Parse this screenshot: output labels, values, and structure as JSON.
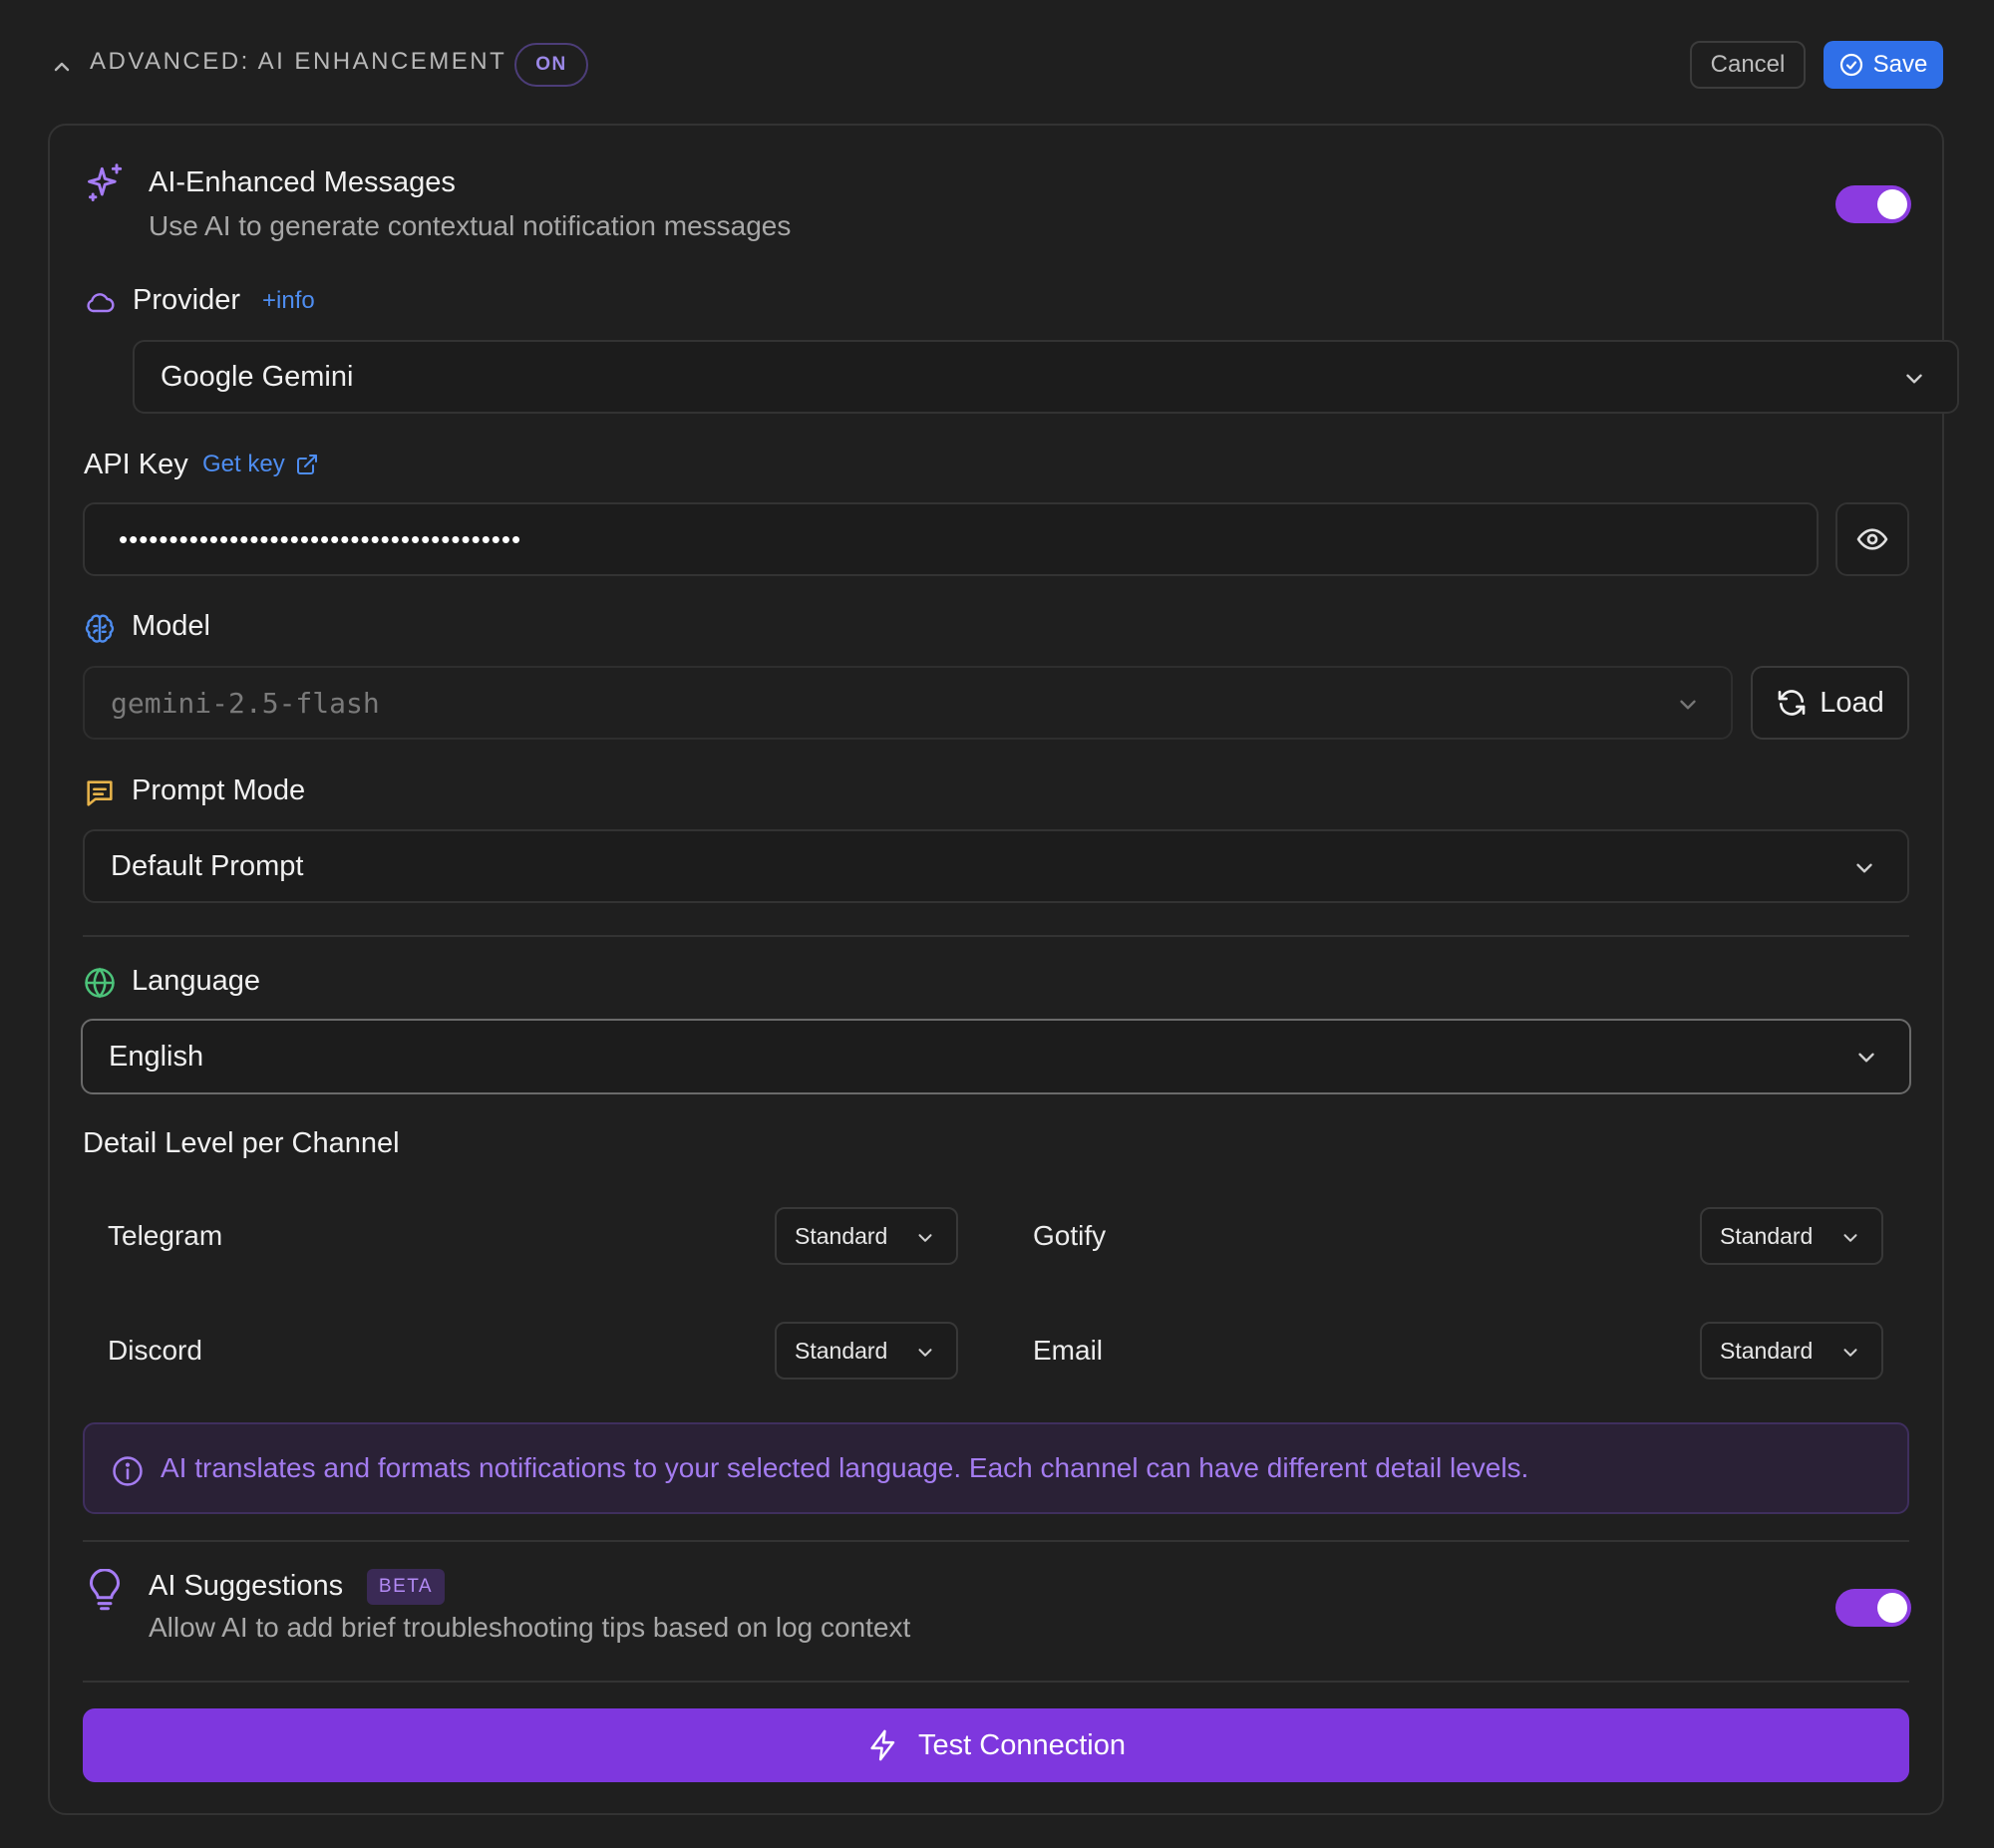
{
  "header": {
    "section_title": "ADVANCED: AI ENHANCEMENT",
    "status_badge": "ON",
    "cancel_label": "Cancel",
    "save_label": "Save"
  },
  "ai_messages": {
    "title": "AI-Enhanced Messages",
    "description": "Use AI to generate contextual notification messages",
    "enabled": true
  },
  "provider": {
    "label": "Provider",
    "info_link": "+info",
    "value": "Google Gemini"
  },
  "api_key": {
    "label": "API Key",
    "get_key_link": "Get key",
    "masked_value": "••••••••••••••••••••••••••••••••••••••••"
  },
  "model": {
    "label": "Model",
    "value": "gemini-2.5-flash",
    "load_label": "Load"
  },
  "prompt_mode": {
    "label": "Prompt Mode",
    "value": "Default Prompt"
  },
  "language": {
    "label": "Language",
    "value": "English"
  },
  "detail_level": {
    "heading": "Detail Level per Channel",
    "channels": [
      {
        "name": "Telegram",
        "level": "Standard"
      },
      {
        "name": "Gotify",
        "level": "Standard"
      },
      {
        "name": "Discord",
        "level": "Standard"
      },
      {
        "name": "Email",
        "level": "Standard"
      }
    ]
  },
  "info_note": "AI translates and formats notifications to your selected language. Each channel can have different detail levels.",
  "ai_suggestions": {
    "title": "AI Suggestions",
    "badge": "BETA",
    "description": "Allow AI to add brief troubleshooting tips based on log context",
    "enabled": true
  },
  "test_connection_label": "Test Connection",
  "colors": {
    "background": "#1f1f1f",
    "accent_purple": "#8b3be0",
    "button_blue": "#2f6fe8",
    "link_blue": "#4e8df0"
  }
}
